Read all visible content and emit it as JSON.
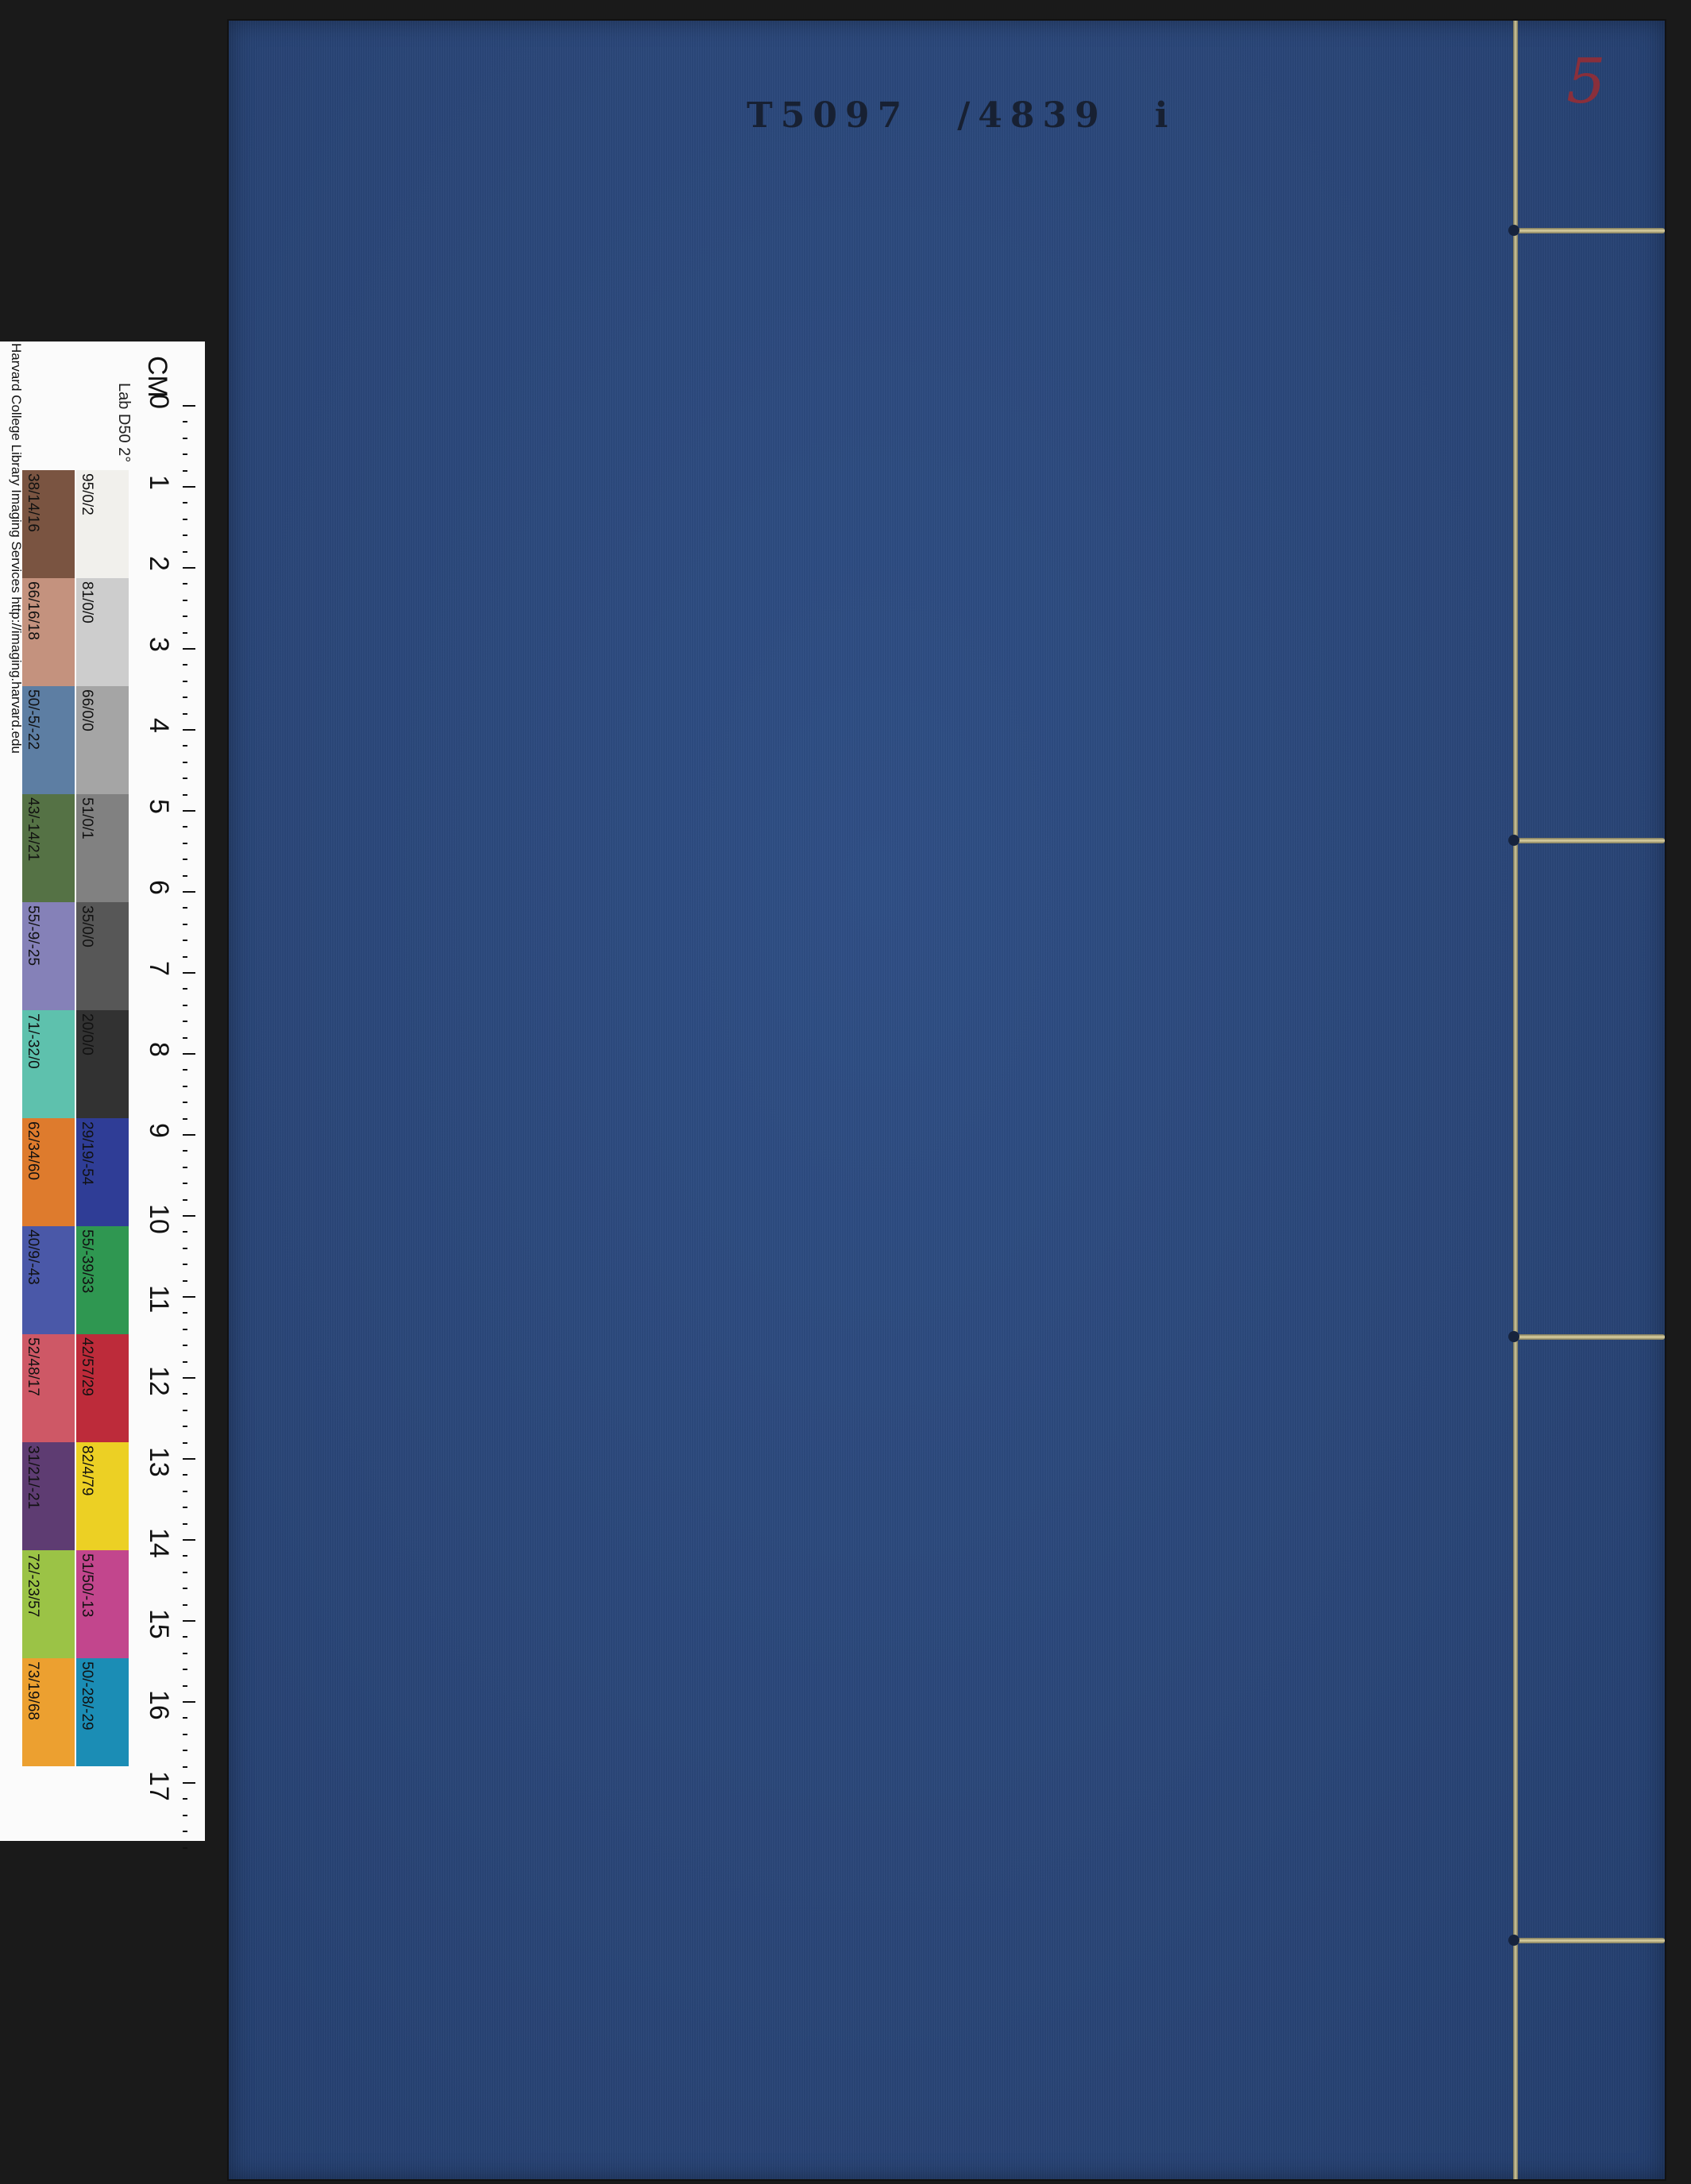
{
  "cover": {
    "color": "#2c4a7e",
    "call_number_part1": "T5097",
    "call_number_part2": "/4839",
    "call_number_mark": "i",
    "volume_mark": "5"
  },
  "card": {
    "credit": "Harvard College Library Imaging Services http://imaging.harvard.edu",
    "lab_label": "Lab D50 2°",
    "lab_first_value": "95/0/2",
    "unit": "CM",
    "ruler_numbers": [
      "0",
      "1",
      "2",
      "3",
      "4",
      "5",
      "6",
      "7",
      "8",
      "9",
      "10",
      "11",
      "12",
      "13",
      "14",
      "15",
      "16",
      "17"
    ],
    "left_patches": [
      {
        "label": "38/14/16",
        "color": "#7a5441"
      },
      {
        "label": "66/16/18",
        "color": "#c4927e"
      },
      {
        "label": "50/-5/-22",
        "color": "#5d7ea3"
      },
      {
        "label": "43/-14/21",
        "color": "#557245"
      },
      {
        "label": "55/-9/-25",
        "color": "#8581b8"
      },
      {
        "label": "71/-32/0",
        "color": "#5ec1ad"
      },
      {
        "label": "62/34/60",
        "color": "#de7b2d"
      },
      {
        "label": "40/9/-43",
        "color": "#4a58a8"
      },
      {
        "label": "52/48/17",
        "color": "#ce5866"
      },
      {
        "label": "31/21/-21",
        "color": "#5e3c72"
      },
      {
        "label": "72/-23/57",
        "color": "#9bc346"
      },
      {
        "label": "73/19/68",
        "color": "#eca030"
      }
    ],
    "right_patches": [
      {
        "label": "95/0/2",
        "color": "#f1f0ec"
      },
      {
        "label": "81/0/0",
        "color": "#cdcdcd"
      },
      {
        "label": "66/0/0",
        "color": "#a5a5a5"
      },
      {
        "label": "51/0/1",
        "color": "#818181"
      },
      {
        "label": "35/0/0",
        "color": "#575757"
      },
      {
        "label": "20/0/0",
        "color": "#323232"
      },
      {
        "label": "29/19/-54",
        "color": "#2f3d96"
      },
      {
        "label": "55/-39/33",
        "color": "#2f9751"
      },
      {
        "label": "42/57/29",
        "color": "#bd2b3a"
      },
      {
        "label": "82/4/79",
        "color": "#ecd024"
      },
      {
        "label": "51/50/-13",
        "color": "#c2468d"
      },
      {
        "label": "50/-28/-29",
        "color": "#1b8db5"
      }
    ]
  }
}
